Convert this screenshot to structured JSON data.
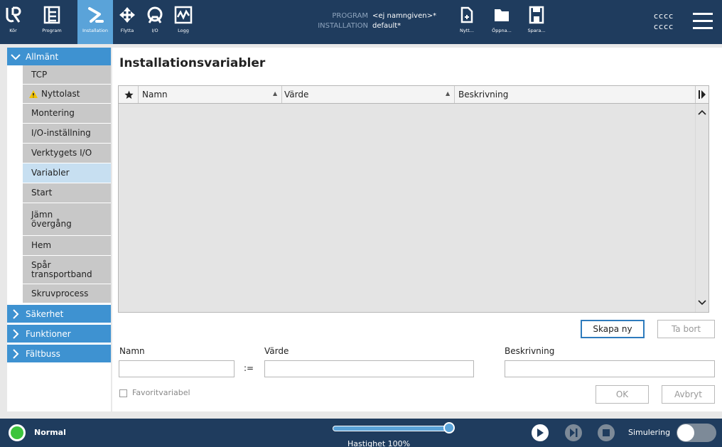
{
  "header": {
    "nav": [
      {
        "label": "Kör",
        "icon": "ur-logo-icon"
      },
      {
        "label": "Program",
        "icon": "program-tree-icon"
      },
      {
        "label": "Installation",
        "icon": "installation-arm-icon",
        "active": true
      },
      {
        "label": "Flytta",
        "icon": "move-arrows-icon"
      },
      {
        "label": "I/O",
        "icon": "io-icon"
      },
      {
        "label": "Logg",
        "icon": "log-graph-icon"
      }
    ],
    "program_key": "PROGRAM",
    "program_value": "<ej namngiven>*",
    "installation_key": "INSTALLATION",
    "installation_value": "default*",
    "file_buttons": [
      {
        "label": "Nytt...",
        "icon": "new-file-icon"
      },
      {
        "label": "Öppna...",
        "icon": "folder-icon"
      },
      {
        "label": "Spara...",
        "icon": "save-icon"
      }
    ],
    "robot_line1": "cccc",
    "robot_line2": "cccc",
    "accent_color": "#5aa3d9",
    "bar_color": "#1f3c5e"
  },
  "sidebar": {
    "sections": [
      {
        "label": "Allmänt",
        "expanded": true
      },
      {
        "label": "Säkerhet",
        "expanded": false
      },
      {
        "label": "Funktioner",
        "expanded": false
      },
      {
        "label": "Fältbuss",
        "expanded": false
      }
    ],
    "items": [
      {
        "label": "TCP"
      },
      {
        "label": "Nyttolast",
        "warning": true
      },
      {
        "label": "Montering"
      },
      {
        "label": "I/O-inställning"
      },
      {
        "label": "Verktygets I/O"
      },
      {
        "label": "Variabler",
        "selected": true
      },
      {
        "label": "Start"
      },
      {
        "label": "Jämn övergång"
      },
      {
        "label": "Hem"
      },
      {
        "label": "Spår transportband"
      },
      {
        "label": "Skruvprocess"
      }
    ]
  },
  "main": {
    "title": "Installationsvariabler",
    "table": {
      "columns": [
        "Namn",
        "Värde",
        "Beskrivning"
      ],
      "rows": []
    },
    "buttons": {
      "create": "Skapa ny",
      "delete": "Ta bort",
      "ok": "OK",
      "cancel": "Avbryt"
    },
    "form": {
      "name_label": "Namn",
      "value_label": "Värde",
      "description_label": "Beskrivning",
      "assign_op": ":=",
      "name_value": "",
      "value_value": "",
      "description_value": "",
      "favorite_label": "Favoritvariabel",
      "favorite_checked": false
    }
  },
  "footer": {
    "status": "Normal",
    "status_color": "#3cc43c",
    "speed_label": "Hastighet 100%",
    "speed_percent": 100,
    "simulation_label": "Simulering",
    "simulation_on": false
  }
}
